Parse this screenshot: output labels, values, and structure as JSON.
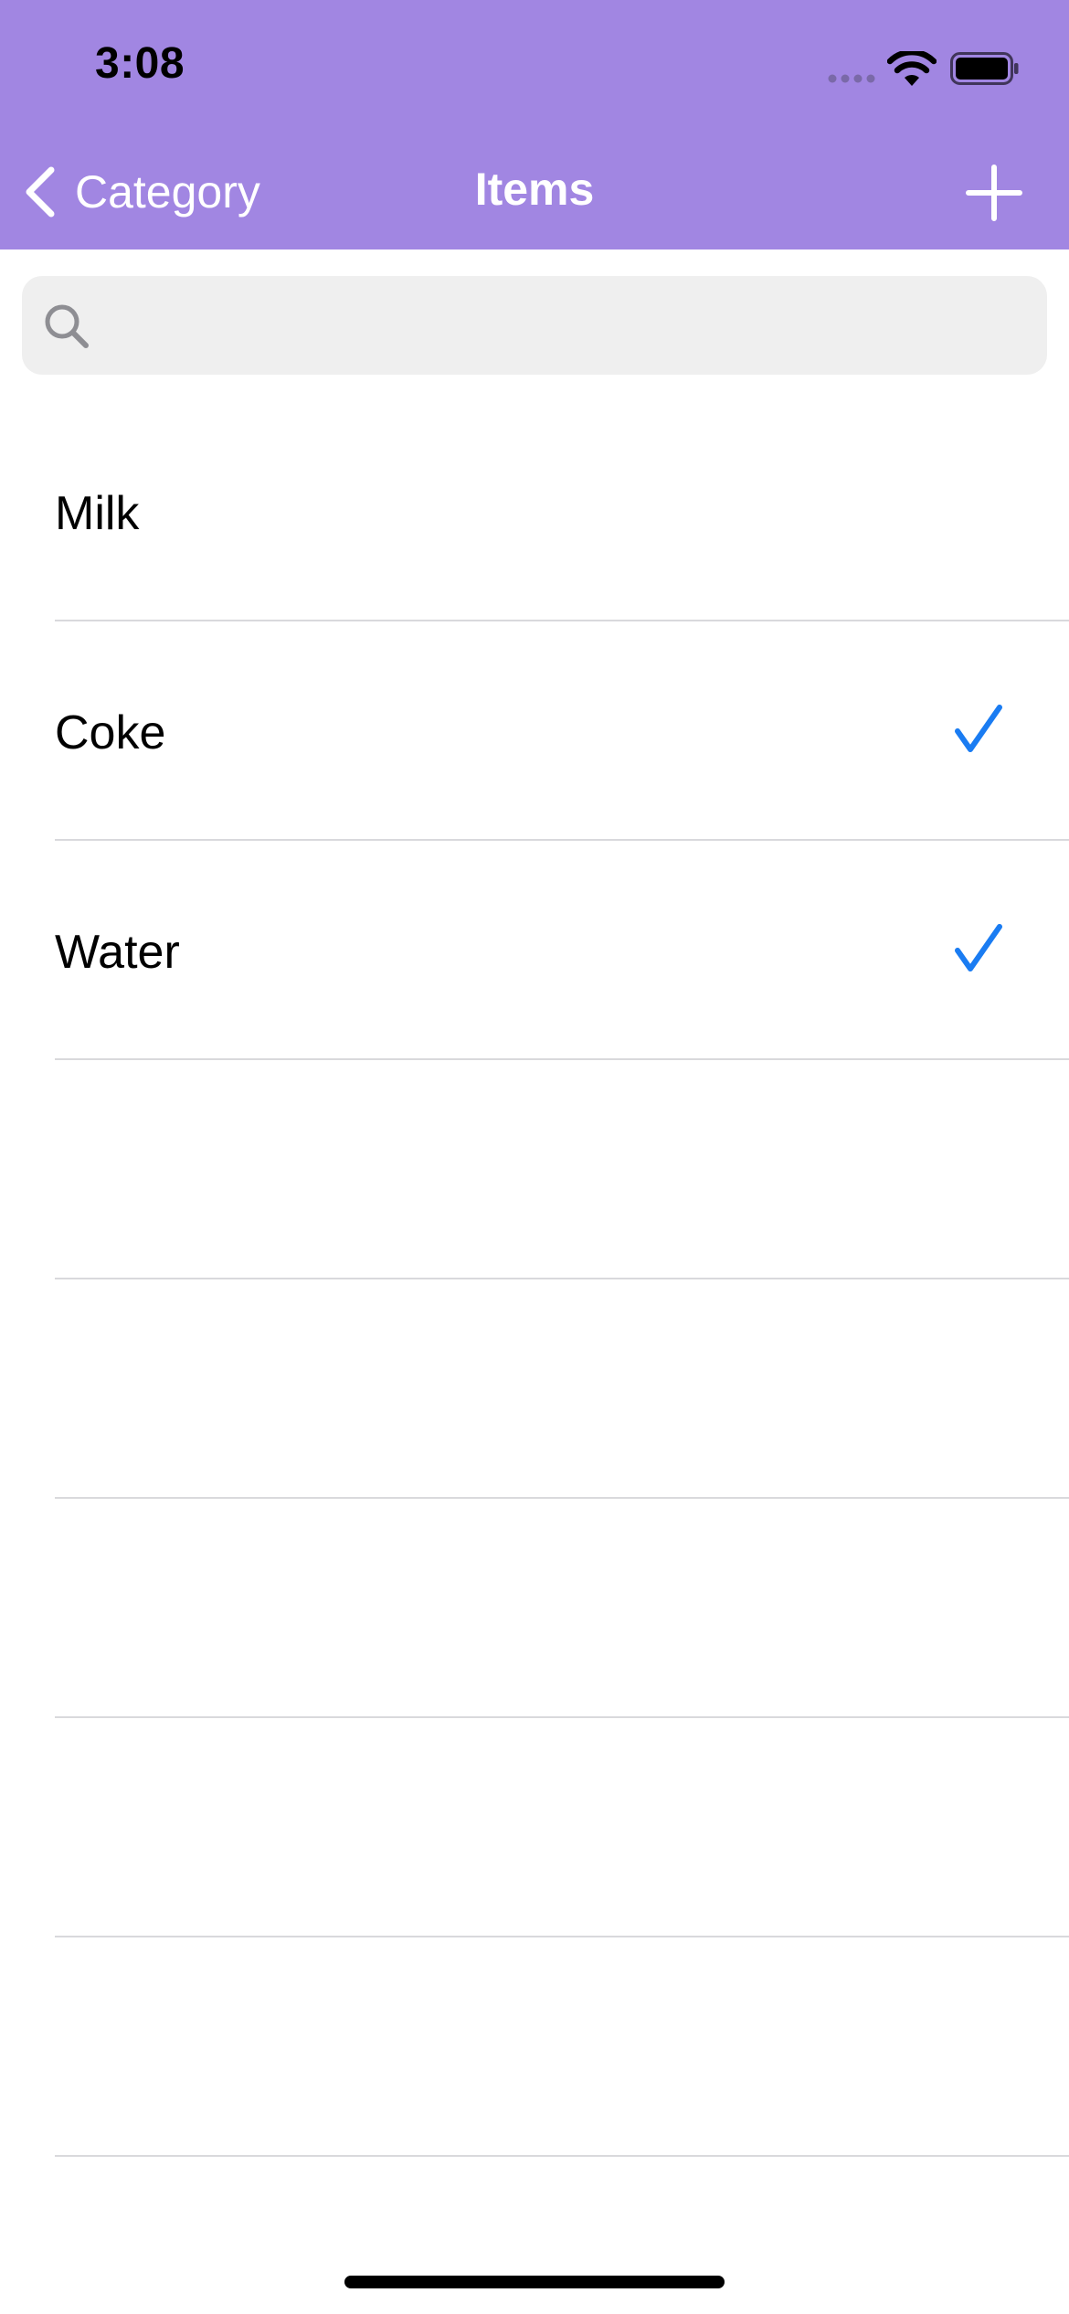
{
  "status_bar": {
    "time": "3:08",
    "icons": [
      "signal-dots-icon",
      "wifi-icon",
      "battery-icon"
    ]
  },
  "nav": {
    "back_label": "Category",
    "title": "Items",
    "back_icon": "chevron-left-icon",
    "add_icon": "plus-icon"
  },
  "search": {
    "placeholder": "",
    "value": "",
    "icon": "search-icon"
  },
  "items": [
    {
      "label": "Milk",
      "checked": false
    },
    {
      "label": "Coke",
      "checked": true
    },
    {
      "label": "Water",
      "checked": true
    },
    {
      "label": "",
      "checked": false
    },
    {
      "label": "",
      "checked": false
    },
    {
      "label": "",
      "checked": false
    },
    {
      "label": "",
      "checked": false
    },
    {
      "label": "",
      "checked": false
    }
  ],
  "colors": {
    "header_background": "#a186e2",
    "checkmark": "#1a7cf2",
    "separator": "#d9d9dc",
    "search_background": "#efefef"
  }
}
